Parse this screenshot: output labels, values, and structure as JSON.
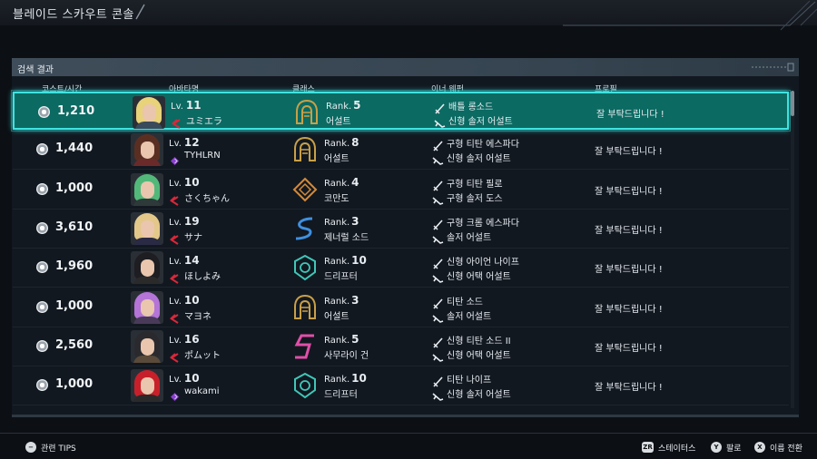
{
  "title": "블레이드 스카우트 콘솔",
  "panel": {
    "title": "검색 결과"
  },
  "columns": {
    "cost": "코스트/시간",
    "avatar": "아바타명",
    "class": "클래스",
    "weapon": "이너 웨펀",
    "profile": "프로필"
  },
  "lv_prefix": "Lv.",
  "rank_prefix": "Rank.",
  "rows": [
    {
      "cost": "1,210",
      "level": "11",
      "name": "ユミエラ",
      "rank": "5",
      "class": "어설트",
      "weapon1": "배틀 롱소드",
      "weapon2": "신형 솔저 어설트",
      "profile": "잘 부탁드립니다 !",
      "selected": true
    },
    {
      "cost": "1,440",
      "level": "12",
      "name": "TYHLRN",
      "rank": "8",
      "class": "어설트",
      "weapon1": "구형 티탄 에스파다",
      "weapon2": "신형 솔저 어설트",
      "profile": "잘 부탁드립니다 !"
    },
    {
      "cost": "1,000",
      "level": "10",
      "name": "さくちゃん",
      "rank": "4",
      "class": "코만도",
      "weapon1": "구형 티탄 필로",
      "weapon2": "구형 솔저 도스",
      "profile": "잘 부탁드립니다 !"
    },
    {
      "cost": "3,610",
      "level": "19",
      "name": "サナ",
      "rank": "3",
      "class": "제너럴 소드",
      "weapon1": "구형 크롬 에스파다",
      "weapon2": "솔저 어설트",
      "profile": "잘 부탁드립니다 !"
    },
    {
      "cost": "1,960",
      "level": "14",
      "name": "ほしよみ",
      "rank": "10",
      "class": "드리프터",
      "weapon1": "신형 아이언 나이프",
      "weapon2": "신형 어택 어설트",
      "profile": "잘 부탁드립니다 !"
    },
    {
      "cost": "1,000",
      "level": "10",
      "name": "マヨネ",
      "rank": "3",
      "class": "어설트",
      "weapon1": "티탄 소드",
      "weapon2": "솔저 어설트",
      "profile": "잘 부탁드립니다 !"
    },
    {
      "cost": "2,560",
      "level": "16",
      "name": "ポムット",
      "rank": "5",
      "class": "사무라이 건",
      "weapon1": "신형 티탄 소드 II",
      "weapon2": "신형 어택 어설트",
      "profile": "잘 부탁드립니다 !"
    },
    {
      "cost": "1,000",
      "level": "10",
      "name": "wakami",
      "rank": "10",
      "class": "드리프터",
      "weapon1": "티탄 나이프",
      "weapon2": "신형 솔저 어설트",
      "profile": "잘 부탁드립니다 !"
    }
  ],
  "footer": {
    "tips": "관련 TIPS",
    "status_key": "ZR",
    "status": "스테이터스",
    "profile_key": "Y",
    "profile": "팔로",
    "name_key": "X",
    "name_switch": "이름 전환",
    "tips_key": "−"
  },
  "colors": {
    "selected_bg": "#0b6a62",
    "selected_border": "#3fe3e0",
    "char_icon_red": "#d8283a",
    "char_icon_purple": "#8a3fd0",
    "class_gold": "#c9a047",
    "class_teal": "#3fc7b8",
    "class_blue": "#3f8fe0",
    "class_pink": "#e04fa8",
    "class_orange": "#d48a3a"
  },
  "icons": {
    "class": [
      "assault-icon",
      "assault-icon",
      "commando-icon",
      "general-sword-icon",
      "drifter-icon",
      "assault-icon",
      "samurai-gun-icon",
      "drifter-icon"
    ],
    "char": [
      "red-chevron-icon",
      "purple-gem-icon",
      "red-chevron-icon",
      "red-chevron-icon",
      "red-chevron-icon",
      "red-chevron-icon",
      "red-chevron-icon",
      "purple-gem-icon"
    ]
  }
}
